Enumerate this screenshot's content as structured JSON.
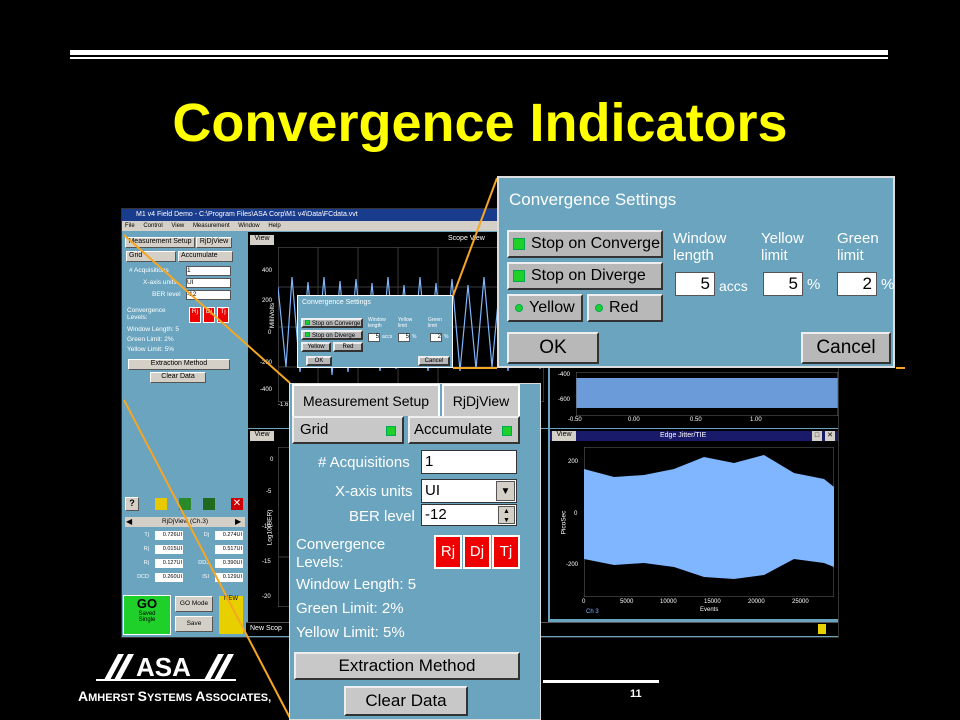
{
  "slide": {
    "title": "Convergence Indicators",
    "page_number": "11",
    "footer": {
      "logo_text": "ASA",
      "company_first": "A",
      "company_rest": "MHERST ",
      "company_s": "S",
      "company_ystems": "YSTEMS ",
      "company_a": "A",
      "company_ssociates": "SSOCIATES,"
    }
  },
  "window": {
    "title": "M1 v4 Field Demo - C:\\Program Files\\ASA Corp\\M1 v4\\Data\\FCdata.vvt",
    "menu": [
      "File",
      "Control",
      "View",
      "Measurement",
      "Window",
      "Help"
    ]
  },
  "left_panel": {
    "tabs": [
      "Measurement Setup",
      "RjDjView"
    ],
    "grid_label": "Grid",
    "accumulate_label": "Accumulate",
    "acquisitions_label": "# Acquisitions",
    "acquisitions_value": "1",
    "xaxis_label": "X-axis units",
    "xaxis_value": "UI",
    "ber_label": "BER level",
    "ber_value": "-12",
    "conv_label": "Convergence Levels:",
    "rj": "Rj",
    "dj": "Dj",
    "tj": "Tj",
    "window_length": "Window Length: 5",
    "green_limit": "Green Limit: 2%",
    "yellow_limit": "Yellow Limit: 5%",
    "extraction_label": "Extraction Method",
    "clear_label": "Clear Data",
    "rjdj_header": "RjDjView (Ch.3)",
    "table": [
      [
        "Tj",
        "0.726UI",
        "Dj",
        "0.274UI"
      ],
      [
        "Rj",
        "0.015UI",
        "",
        "0.517UI"
      ],
      [
        "Rj",
        "0.127UI",
        "DDJ",
        "0.390UI"
      ],
      [
        "DCD",
        "0.260UI",
        "ISI",
        "0.129UI"
      ]
    ],
    "go_label": "GO",
    "go_sub1": "Saved",
    "go_sub2": "Single",
    "go_mode_label": "GO Mode",
    "save_label": "Save",
    "new_label": "NEW"
  },
  "plots": {
    "view_label": "View",
    "scope_title": "Scope View",
    "scope_yaxis": "MilliVolts",
    "scope_ticks": [
      "400",
      "200",
      "0",
      "-200",
      "-400"
    ],
    "scope_xtick": "-1.6",
    "ber_yaxis": "Log10(BER)",
    "ber_ticks": [
      "0",
      "-5",
      "-10",
      "-15",
      "-20"
    ],
    "eye_ticks_y": [
      "-400",
      "-600"
    ],
    "eye_ticks_x": [
      "-0.50",
      "0.00",
      "0.50",
      "1.00"
    ],
    "eye_xlabel": "UI",
    "edge_title": "Edge Jitter/TIE",
    "edge_yaxis": "PicoSec",
    "edge_ticks_y": [
      "200",
      "0",
      "-200"
    ],
    "edge_ticks_x": [
      "0",
      "5000",
      "10000",
      "15000",
      "20000",
      "25000"
    ],
    "edge_xlabel": "Events",
    "legend": "Ch 3",
    "status_text": "New Scop"
  },
  "small_dialog": {
    "title": "Convergence Settings",
    "stop_converge": "Stop on Converge",
    "stop_diverge": "Stop on Diverge",
    "yellow": "Yellow",
    "red": "Red",
    "ok": "OK",
    "cancel": "Cancel",
    "window_length": "Window length",
    "yellow_limit": "Yellow limit",
    "green_limit": "Green limit",
    "wl_value": "5",
    "yl_value": "5",
    "gl_value": "2",
    "accs": "accs",
    "pct": "%"
  },
  "zoom_dialog": {
    "title": "Convergence Settings",
    "stop_converge": "Stop on Converge",
    "stop_diverge": "Stop on Diverge",
    "yellow": "Yellow",
    "red": "Red",
    "ok": "OK",
    "cancel": "Cancel",
    "window_l1": "Window",
    "window_l2": "length",
    "yellow_l1": "Yellow",
    "yellow_l2": "limit",
    "green_l1": "Green",
    "green_l2": "limit",
    "wl_value": "5",
    "yl_value": "5",
    "gl_value": "2",
    "accs": "accs",
    "pct": "%"
  },
  "colors": {
    "title": "#ffff00",
    "panel": "#6aa4bf",
    "led_green": "#1fcf2a",
    "red": "#ee0000",
    "callout": "#f5a623",
    "waveform": "#7fb6ff"
  }
}
